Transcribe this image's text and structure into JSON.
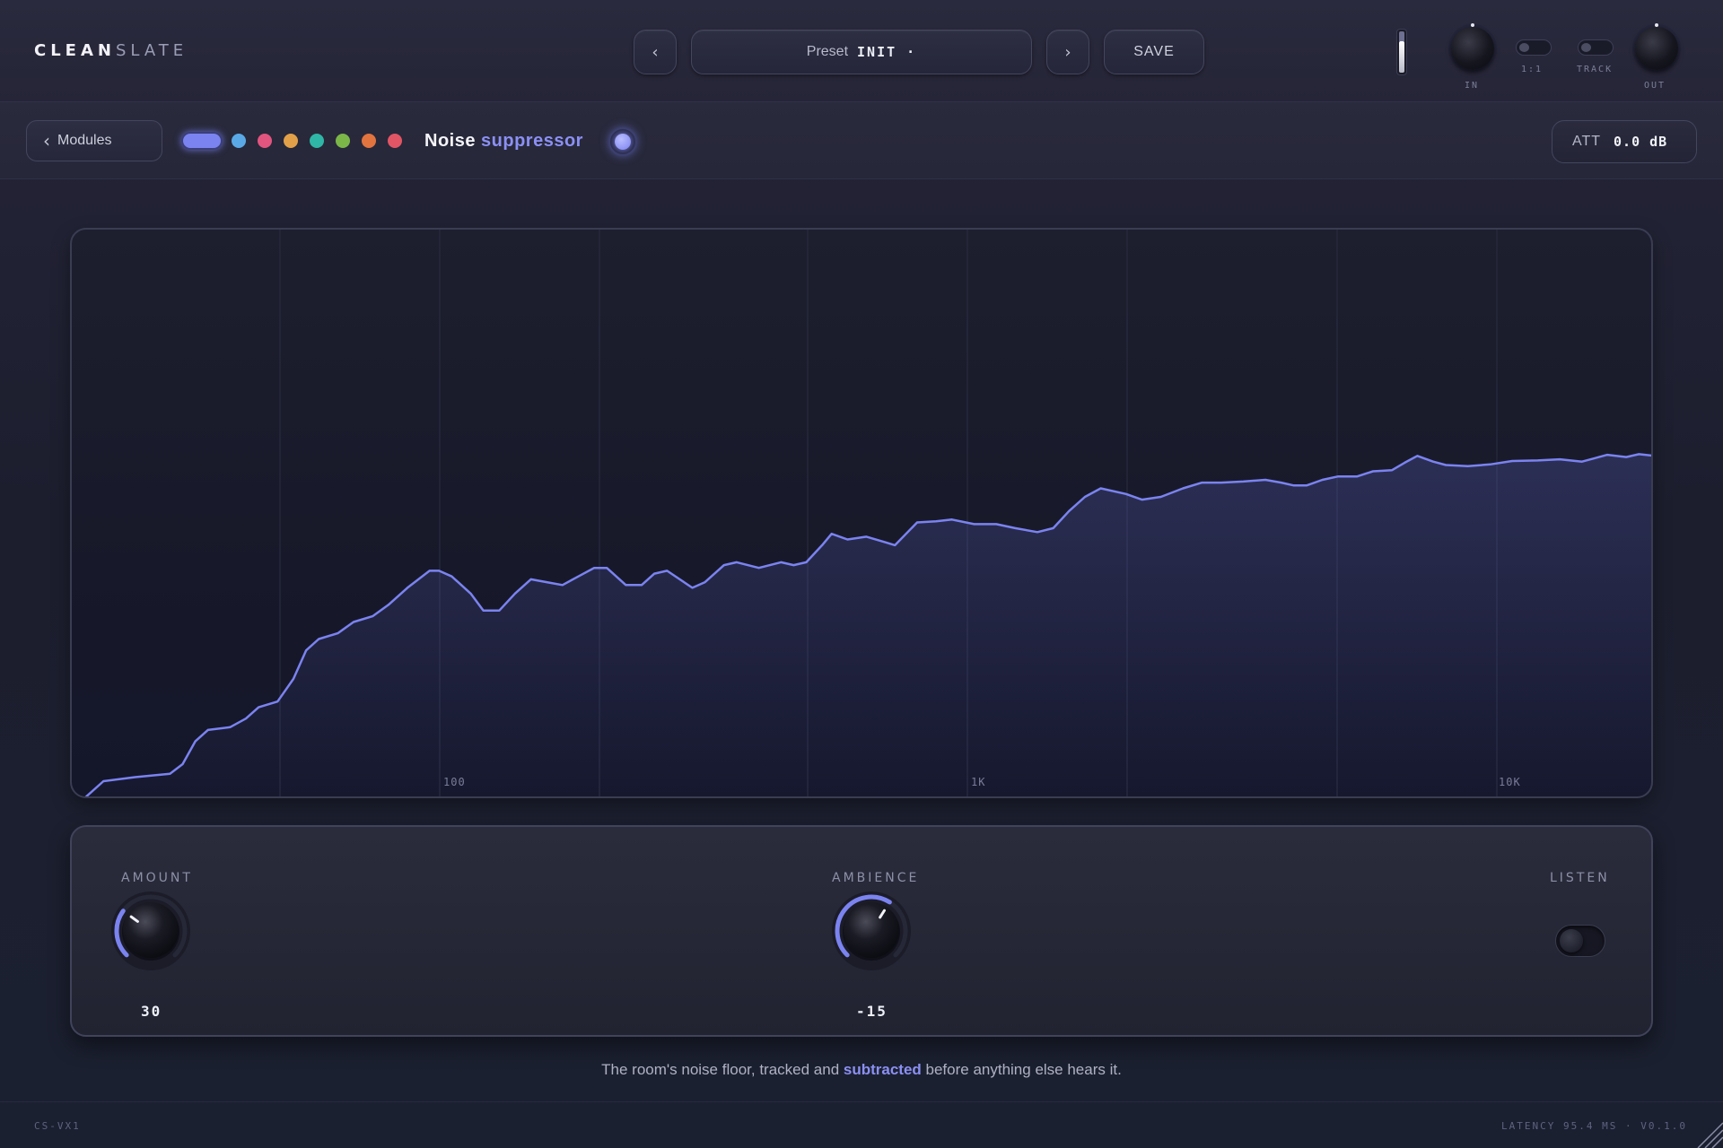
{
  "app": {
    "logo_bold": "CLEAN",
    "logo_light": "SLATE"
  },
  "topbar": {
    "prev_icon": "‹",
    "next_icon": "›",
    "preset_label": "Preset",
    "preset_value": "INIT ·",
    "save_label": "SAVE",
    "in_label": "IN",
    "ratio_label": "1:1",
    "track_label": "TRACK",
    "out_label": "OUT",
    "input_meter_level": 0.7
  },
  "subbar": {
    "back_label": "Modules",
    "back_icon": "chevron-left-icon",
    "color_dots": [
      "#5aa9e6",
      "#e2557e",
      "#e2a148",
      "#2fb6a6",
      "#7bb649",
      "#e2743f",
      "#e25565"
    ],
    "active_dot_color": "#7b83f0",
    "module_title_1": "Noise",
    "module_title_2": "suppressor",
    "att_label": "ATT",
    "att_value": "0.0 dB"
  },
  "spectrum": {
    "line_color": "#7b83f0",
    "tick_labels": [
      "100",
      "1K",
      "10K"
    ],
    "points": [
      [
        0.008,
        0.0
      ],
      [
        0.02,
        0.03
      ],
      [
        0.04,
        0.037
      ],
      [
        0.062,
        0.043
      ],
      [
        0.07,
        0.06
      ],
      [
        0.078,
        0.1
      ],
      [
        0.086,
        0.12
      ],
      [
        0.1,
        0.125
      ],
      [
        0.11,
        0.14
      ],
      [
        0.118,
        0.16
      ],
      [
        0.13,
        0.17
      ],
      [
        0.14,
        0.21
      ],
      [
        0.148,
        0.26
      ],
      [
        0.156,
        0.28
      ],
      [
        0.168,
        0.29
      ],
      [
        0.178,
        0.31
      ],
      [
        0.19,
        0.32
      ],
      [
        0.2,
        0.34
      ],
      [
        0.212,
        0.37
      ],
      [
        0.226,
        0.4
      ],
      [
        0.232,
        0.4
      ],
      [
        0.24,
        0.39
      ],
      [
        0.252,
        0.36
      ],
      [
        0.26,
        0.33
      ],
      [
        0.27,
        0.33
      ],
      [
        0.28,
        0.36
      ],
      [
        0.29,
        0.385
      ],
      [
        0.3,
        0.38
      ],
      [
        0.31,
        0.375
      ],
      [
        0.32,
        0.39
      ],
      [
        0.33,
        0.405
      ],
      [
        0.338,
        0.405
      ],
      [
        0.35,
        0.375
      ],
      [
        0.36,
        0.375
      ],
      [
        0.368,
        0.395
      ],
      [
        0.376,
        0.4
      ],
      [
        0.392,
        0.37
      ],
      [
        0.4,
        0.38
      ],
      [
        0.412,
        0.41
      ],
      [
        0.42,
        0.415
      ],
      [
        0.434,
        0.405
      ],
      [
        0.448,
        0.415
      ],
      [
        0.456,
        0.41
      ],
      [
        0.464,
        0.415
      ],
      [
        0.474,
        0.445
      ],
      [
        0.48,
        0.465
      ],
      [
        0.49,
        0.455
      ],
      [
        0.502,
        0.46
      ],
      [
        0.514,
        0.45
      ],
      [
        0.52,
        0.445
      ],
      [
        0.534,
        0.485
      ],
      [
        0.546,
        0.487
      ],
      [
        0.556,
        0.49
      ],
      [
        0.57,
        0.482
      ],
      [
        0.584,
        0.482
      ],
      [
        0.596,
        0.475
      ],
      [
        0.61,
        0.468
      ],
      [
        0.62,
        0.475
      ],
      [
        0.63,
        0.505
      ],
      [
        0.64,
        0.53
      ],
      [
        0.65,
        0.545
      ],
      [
        0.666,
        0.535
      ],
      [
        0.676,
        0.525
      ],
      [
        0.688,
        0.53
      ],
      [
        0.702,
        0.545
      ],
      [
        0.714,
        0.555
      ],
      [
        0.726,
        0.555
      ],
      [
        0.74,
        0.557
      ],
      [
        0.754,
        0.56
      ],
      [
        0.764,
        0.555
      ],
      [
        0.772,
        0.55
      ],
      [
        0.78,
        0.55
      ],
      [
        0.79,
        0.56
      ],
      [
        0.8,
        0.566
      ],
      [
        0.812,
        0.566
      ],
      [
        0.822,
        0.575
      ],
      [
        0.834,
        0.577
      ],
      [
        0.842,
        0.59
      ],
      [
        0.85,
        0.602
      ],
      [
        0.86,
        0.592
      ],
      [
        0.868,
        0.586
      ],
      [
        0.882,
        0.584
      ],
      [
        0.896,
        0.587
      ],
      [
        0.91,
        0.593
      ],
      [
        0.926,
        0.594
      ],
      [
        0.94,
        0.596
      ],
      [
        0.954,
        0.592
      ],
      [
        0.97,
        0.604
      ],
      [
        0.982,
        0.6
      ],
      [
        0.99,
        0.605
      ],
      [
        1.0,
        0.602
      ]
    ]
  },
  "controls": {
    "amount_label": "AMOUNT",
    "amount_value": "30",
    "amount_fraction": 0.3,
    "ambience_label": "AMBIENCE",
    "ambience_value": "-15",
    "ambience_fraction": 0.62,
    "listen_label": "LISTEN",
    "accent_color": "#7b83f0"
  },
  "caption": {
    "before": "The room's noise floor, tracked and ",
    "highlight": "subtracted",
    "after": " before anything else hears it."
  },
  "footer": {
    "left": "CS-VX1",
    "right": "LATENCY 95.4 MS · V0.1.0"
  }
}
